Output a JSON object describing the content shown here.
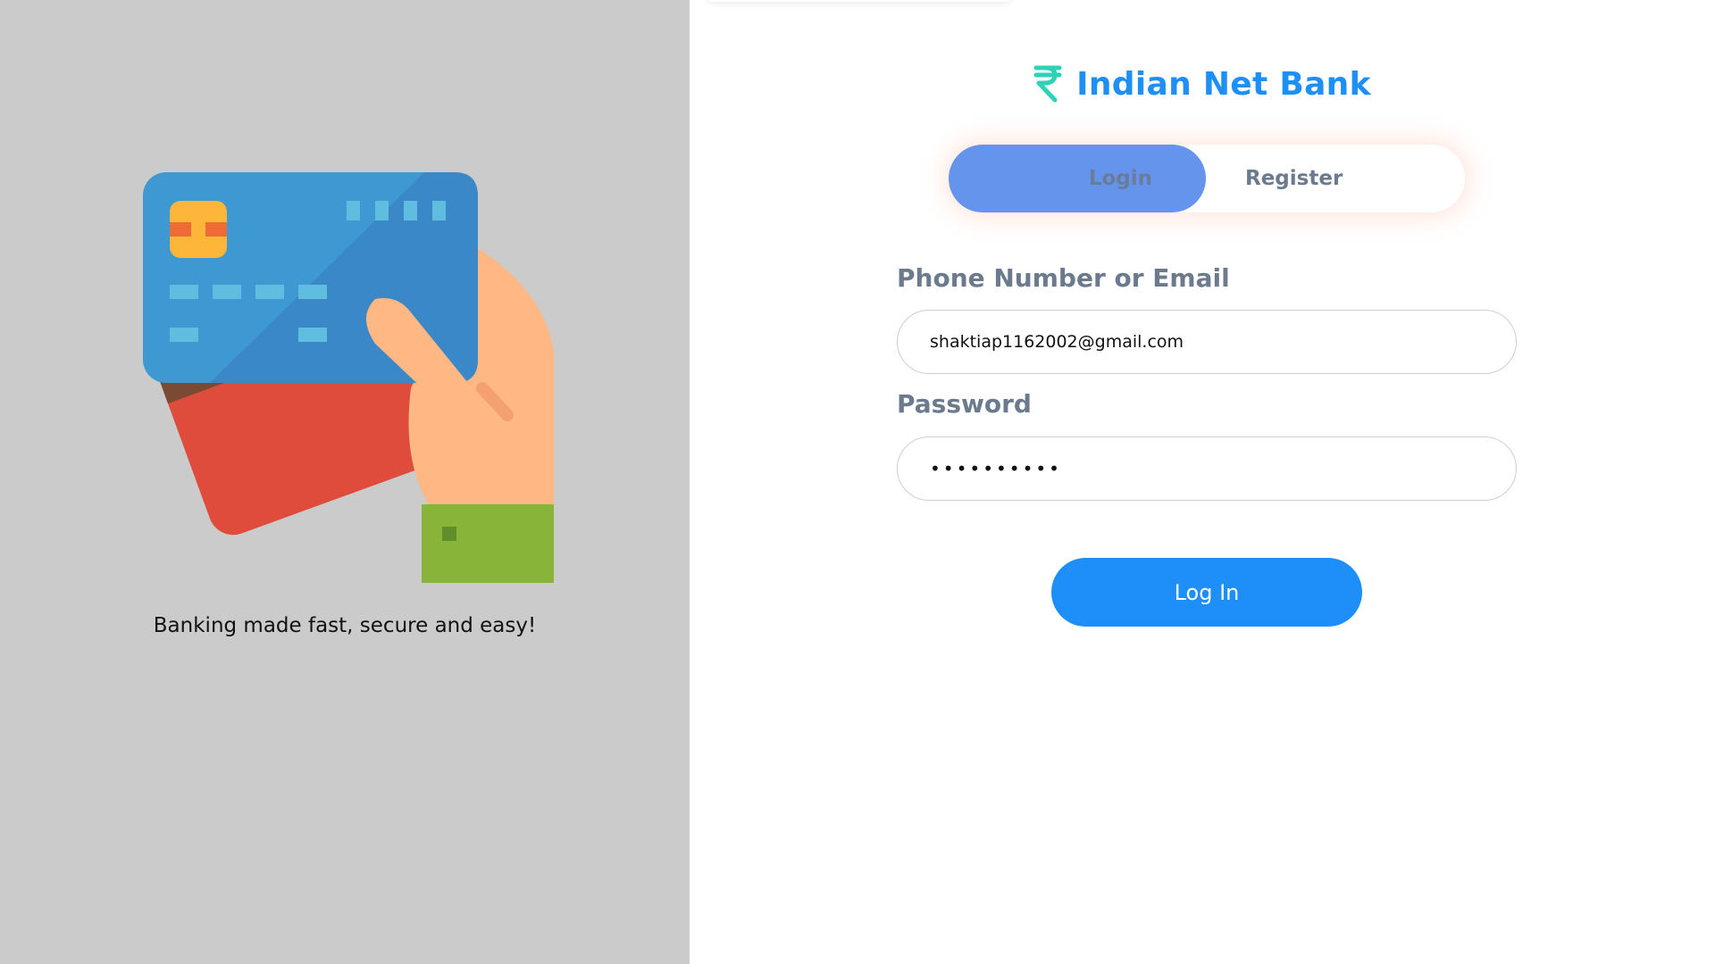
{
  "brand": {
    "title": "Indian Net Bank",
    "icon": "rupee-icon",
    "color": "#1e8ff5",
    "icon_color": "#2ed3b7"
  },
  "left_panel": {
    "tagline": "Banking made fast, secure and easy!",
    "illustration": "hand-holding-credit-cards-icon",
    "background": "#cbcbcb"
  },
  "tabs": [
    {
      "label": "Login",
      "active": true
    },
    {
      "label": "Register",
      "active": false
    }
  ],
  "form": {
    "email_label": "Phone Number or Email",
    "email_value": "shaktiap1162002@gmail.com",
    "password_label": "Password",
    "password_value": "••••••••••",
    "submit_label": "Log In"
  },
  "colors": {
    "active_tab": "#6594ec",
    "button": "#1e8ff8",
    "label": "#6b7a8c"
  }
}
